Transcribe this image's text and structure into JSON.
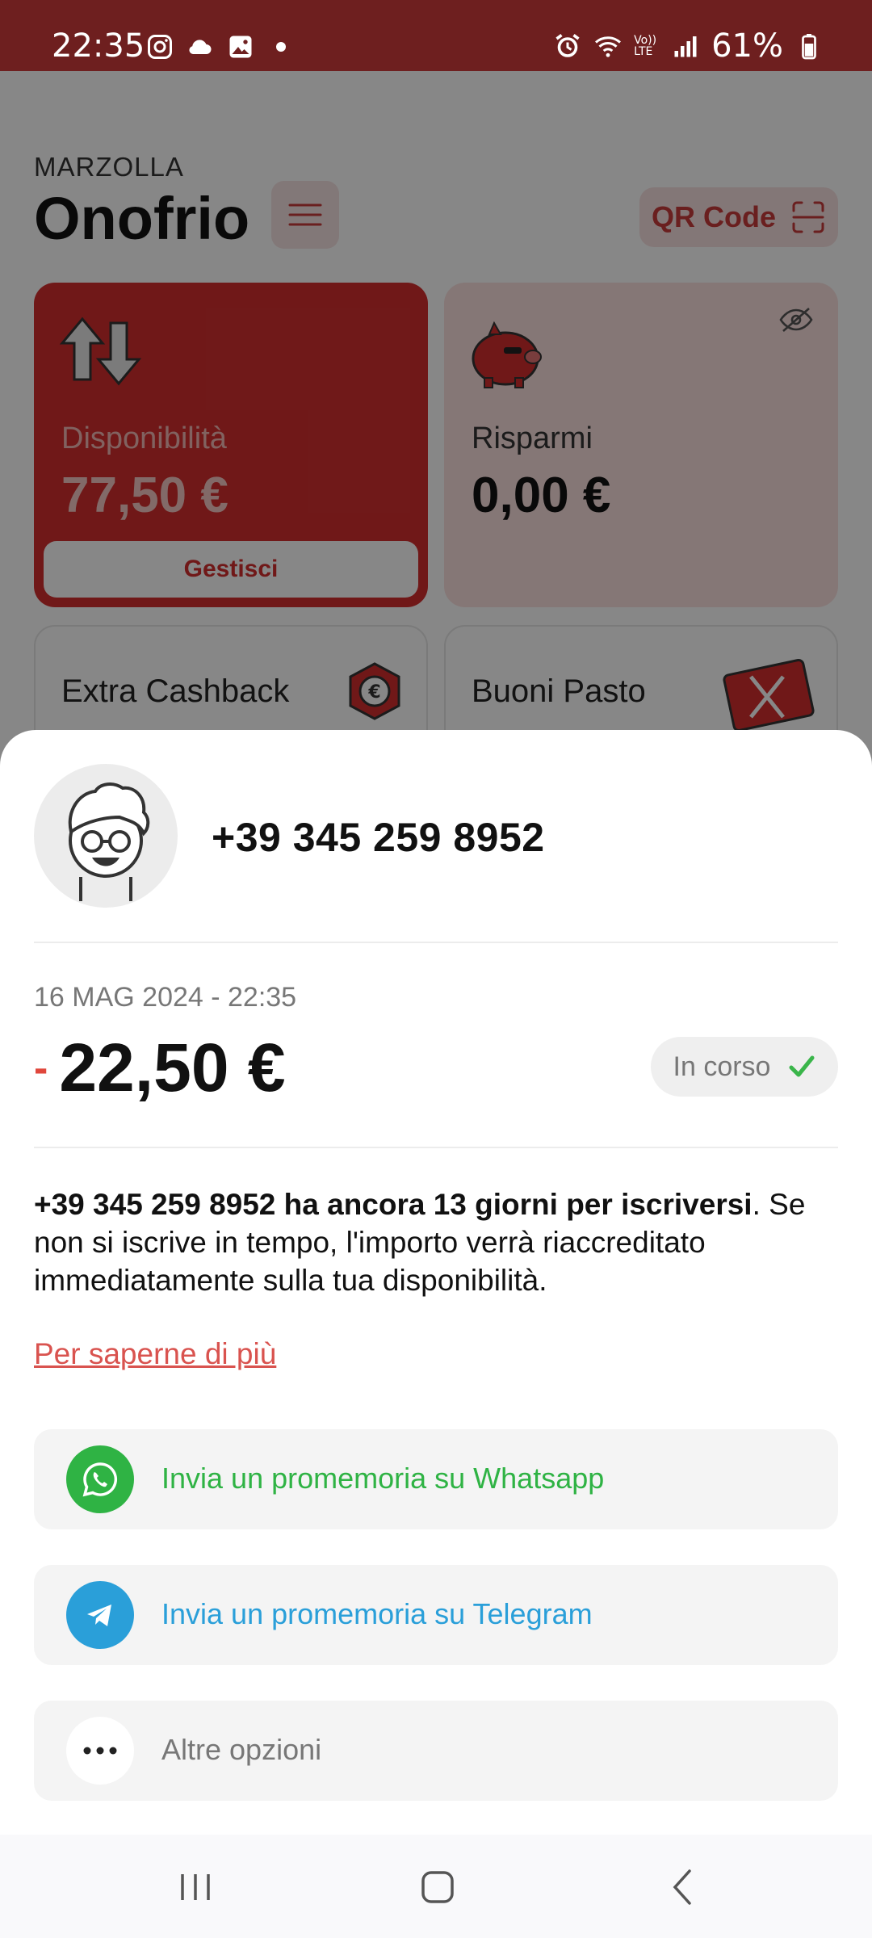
{
  "status_bar": {
    "time": "22:35",
    "battery": "61%",
    "left_icons": [
      "instagram-icon",
      "cloud-icon",
      "gallery-icon",
      "dot-icon"
    ],
    "right_icons": [
      "alarm-icon",
      "wifi-icon",
      "volte-icon",
      "signal-icon",
      "battery-icon"
    ],
    "volte_label": "Vo)) LTE"
  },
  "header": {
    "surname": "MARZOLLA",
    "name": "Onofrio",
    "qr_label": "QR Code"
  },
  "cards": {
    "availability": {
      "label": "Disponibilità",
      "amount": "77,50 €",
      "button": "Gestisci"
    },
    "savings": {
      "label": "Risparmi",
      "amount": "0,00 €"
    },
    "extra_cashback": {
      "label": "Extra Cashback"
    },
    "meal_vouchers": {
      "label": "Buoni Pasto"
    }
  },
  "sheet": {
    "phone": "+39 345 259 8952",
    "date": "16 MAG 2024 - 22:35",
    "sign": "-",
    "amount": "22,50 €",
    "status": "In corso",
    "info_bold": "+39 345 259 8952 ha ancora 13 giorni per iscriversi",
    "info_rest": ". Se non si iscrive in tempo, l'importo verrà riaccreditato immediatamente sulla tua disponibilità.",
    "link": "Per saperne di più",
    "options": [
      {
        "label": "Invia un promemoria su Whatsapp",
        "icon": "whatsapp-icon"
      },
      {
        "label": "Invia un promemoria su Telegram",
        "icon": "telegram-icon"
      },
      {
        "label": "Altre opzioni",
        "icon": "more-icon"
      }
    ]
  },
  "colors": {
    "status_bar": "#6e1f1f",
    "brand_red": "#d32f2f",
    "whatsapp": "#2fb344",
    "telegram": "#2a9fd9",
    "link": "#d9534f",
    "success": "#3ab54a"
  }
}
